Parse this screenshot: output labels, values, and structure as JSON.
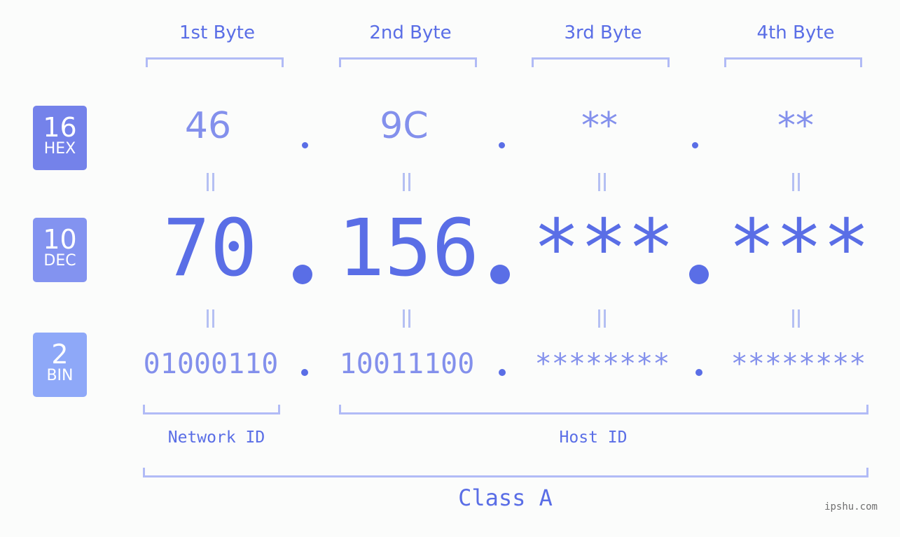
{
  "headers": [
    "1st Byte",
    "2nd Byte",
    "3rd Byte",
    "4th Byte"
  ],
  "badges": {
    "hex": {
      "num": "16",
      "label": "HEX",
      "color": "#7482ea"
    },
    "dec": {
      "num": "10",
      "label": "DEC",
      "color": "#8393f0"
    },
    "bin": {
      "num": "2",
      "label": "BIN",
      "color": "#8ea8f8"
    }
  },
  "hex": [
    "46",
    "9C",
    "**",
    "**"
  ],
  "dec": [
    "70",
    "156",
    "***",
    "***"
  ],
  "bin": [
    "01000110",
    "10011100",
    "********",
    "********"
  ],
  "separator": ".",
  "labels": {
    "network_id": "Network ID",
    "host_id": "Host ID",
    "class": "Class A"
  },
  "watermark": "ipshu.com",
  "colors": {
    "accent": "#5a6ee6",
    "light_accent": "#8390ec",
    "bracket": "#b1bbf6"
  }
}
